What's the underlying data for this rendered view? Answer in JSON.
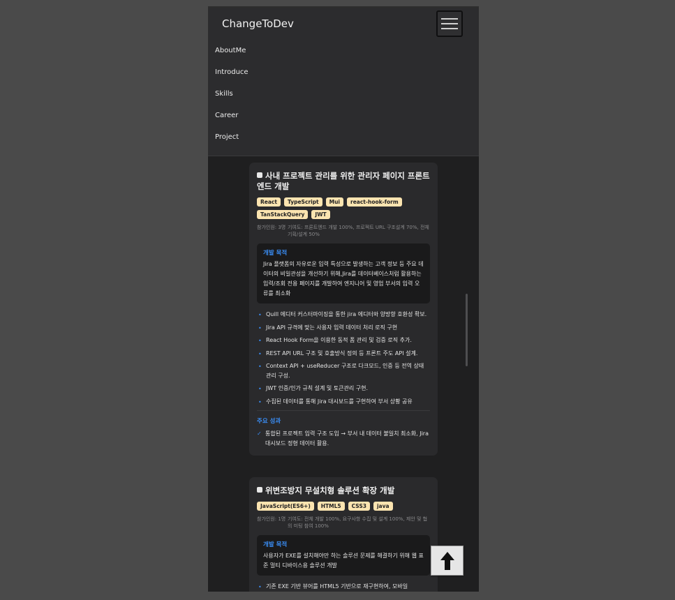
{
  "header": {
    "brand": "ChangeToDev",
    "menu_icon": "hamburger-menu-icon"
  },
  "nav": {
    "items": [
      "AboutMe",
      "Introduce",
      "Skills",
      "Career",
      "Project"
    ]
  },
  "projects": [
    {
      "title": "사내 프로젝트 관리를 위한 관리자 페이지 프론트엔드 개발",
      "tags": [
        "React",
        "TypeScript",
        "Mui",
        "react-hook-form",
        "TanStackQuery",
        "JWT"
      ],
      "people": "참가인원: 3명",
      "contribution": "기여도: 프론트엔드 개발 100%, 프로젝트 URL 구조설계 70%, 전체 기획/설계 50%",
      "purpose_heading": "개발 목적",
      "purpose_text": "Jira 플랫폼의 자유로운 입력 특성으로 발생하는 고객 정보 등 주요 데이터의 비일관성을 개선하기 위해,Jira를 데이터베이스처럼 활용하는 입력/조회 전용 페이지를 개발하여 엔지니어 및 영업 부서의 입력 오류를 최소화",
      "bullets": [
        "Quill 에디터 커스터마이징을 통한 jira 에디터와 양방향 호환성 확보.",
        "Jira API 규격에 맞는 사용자 입력 데이터 처리 로직 구현",
        "React Hook Form을 이용한 동적 폼 관리 및 검증 로직 추가.",
        "REST API URL 구조 및 호출방식 정의 등 프론트 주도 API 설계.",
        "Context API + useReducer 구조로 다크모드, 인증 등 전역 상태 관리 구성.",
        "JWT 인증/인가 규칙 설계 및 토큰관리 구현.",
        "수집된 데이터를 통해 Jira 대시보드를 구현하여 부서 상황 공유"
      ],
      "result_heading": "주요 성과",
      "result_text": "통합된 프로젝트 입력 구조 도입 → 부서 내 데이터 불일치 최소화, Jira 대시보드 정형 데이터 활용."
    },
    {
      "title": "위변조방지 무설치형 솔루션 확장 개발",
      "tags": [
        "JavaScript(ES6+)",
        "HTML5",
        "CSS3",
        "java"
      ],
      "people": "참가인원: 1명",
      "contribution": "기여도: 전체 개발 100%, 요구사항 수집 및 설계 100%, 제안 및 협의 미팅 참여 100%",
      "purpose_heading": "개발 목적",
      "purpose_text": "사용자가 EXE를 설치해야만 하는 솔루션 문제를 해결하기 위해 웹 표준 멀티 디바이스용 솔루션 개발",
      "bullets": [
        "기존 EXE 기반 뷰어를 HTML5 기반으로 재구현하여, 모바일"
      ]
    }
  ],
  "scroll_top_button": {
    "icon": "arrow-up-icon"
  },
  "colors": {
    "accent": "#3a8ef6",
    "tag_bg": "#fbe4b0",
    "card_bg": "#2a2a2c",
    "page_bg": "#1f1f20"
  }
}
